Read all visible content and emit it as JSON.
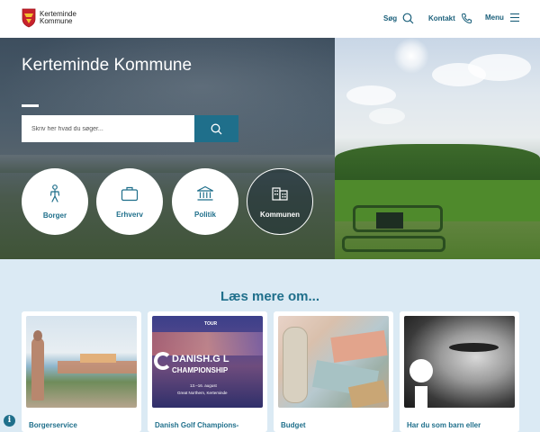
{
  "header": {
    "logo_line1": "Kerteminde",
    "logo_line2": "Kommune",
    "nav": [
      {
        "label": "Søg",
        "icon": "search-icon"
      },
      {
        "label": "Kontakt",
        "icon": "phone-icon"
      },
      {
        "label": "Menu",
        "icon": "hamburger-icon"
      }
    ]
  },
  "hero": {
    "title": "Kerteminde Kommune",
    "search_placeholder": "Skriv her hvad du søger...",
    "categories": [
      {
        "label": "Borger",
        "icon": "person-icon"
      },
      {
        "label": "Erhverv",
        "icon": "briefcase-icon"
      },
      {
        "label": "Politik",
        "icon": "government-building-icon"
      },
      {
        "label": "Kommunen",
        "icon": "office-building-icon",
        "active": true
      }
    ]
  },
  "read_more": {
    "title": "Læs mere om...",
    "cards": [
      {
        "title": "Borgerservice",
        "image": "harbour-statue-photo"
      },
      {
        "title": "Danish Golf Champions-",
        "image": "golf-championship-poster",
        "poster": {
          "tour": "TOUR",
          "name_top": "DANISH.G  L",
          "name_bottom": "CHAMPIONSHIP",
          "dates": "13.–16. august",
          "venue": "Great Northern, Kerteminde"
        }
      },
      {
        "title": "Budget",
        "image": "banknotes-photo"
      },
      {
        "title": "Har du som barn eller",
        "image": "child-face-photo"
      }
    ]
  },
  "info_badge": "i",
  "colors": {
    "accent": "#1f6f8b",
    "lower_bg": "#dbeaf4",
    "nav_text": "#1a5f7a"
  }
}
